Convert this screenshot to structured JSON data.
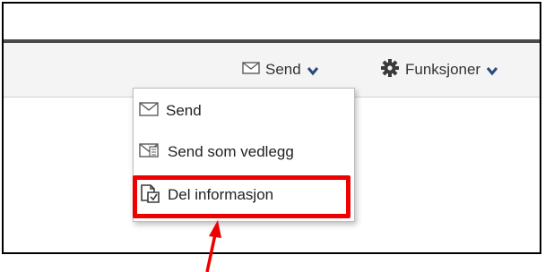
{
  "toolbar": {
    "send_label": "Send",
    "send_icon": "envelope-icon",
    "functions_label": "Funksjoner",
    "functions_icon": "gear-icon"
  },
  "send_menu": {
    "items": [
      {
        "label": "Send",
        "icon": "envelope-icon"
      },
      {
        "label": "Send som vedlegg",
        "icon": "attachment-envelope-icon"
      },
      {
        "label": "Del informasjon",
        "icon": "share-document-icon"
      }
    ]
  },
  "annotation": {
    "highlight_color": "#ee0000",
    "highlight_target": "Del informasjon"
  }
}
